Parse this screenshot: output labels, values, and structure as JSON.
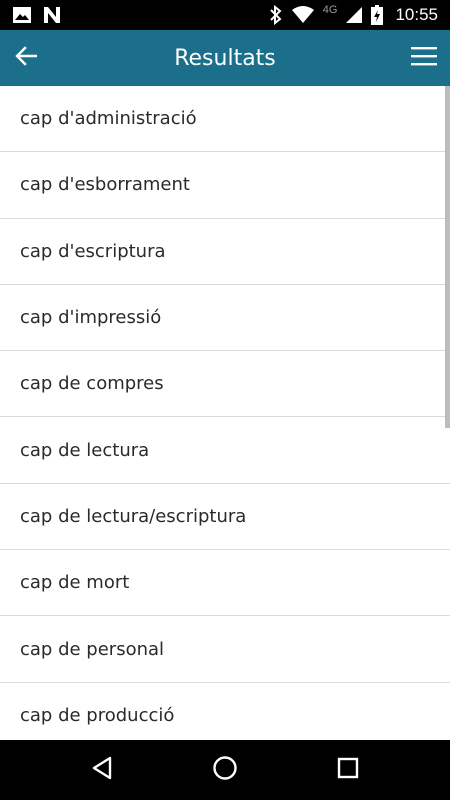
{
  "status_bar": {
    "time": "10:55",
    "network": "4G",
    "icons": [
      "image-icon",
      "n-app-icon",
      "bluetooth-icon",
      "wifi-icon",
      "signal-icon",
      "battery-charging-icon"
    ]
  },
  "app_bar": {
    "title": "Resultats",
    "back_icon": "arrow-left-icon",
    "menu_icon": "hamburger-menu-icon",
    "background": "#1b6f8a"
  },
  "results": [
    "cap d'administració",
    "cap d'esborrament",
    "cap d'escriptura",
    "cap d'impressió",
    "cap de compres",
    "cap de lectura",
    "cap de lectura/escriptura",
    "cap de mort",
    "cap de personal",
    "cap de producció"
  ],
  "nav_bar": {
    "icons": [
      "back-triangle-icon",
      "home-circle-icon",
      "recents-square-icon"
    ]
  }
}
